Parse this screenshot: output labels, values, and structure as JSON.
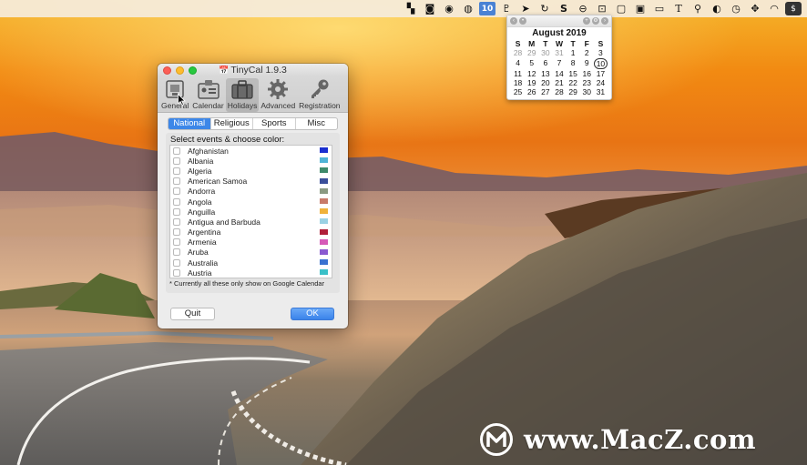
{
  "menubar": {
    "date_badge": "10",
    "icons": [
      "crop-icon",
      "camera-icon",
      "mic-icon",
      "globe-icon",
      "date-badge",
      "pin-icon",
      "send-icon",
      "refresh-icon",
      "s-icon",
      "display-icon",
      "box-icon",
      "window-icon",
      "screen-icon",
      "monitor-icon",
      "text-icon",
      "search-icon",
      "color-icon",
      "clock-icon",
      "drag-icon",
      "wifi-icon",
      "s-app-icon"
    ],
    "text_glyphs": {
      "s": "S",
      "text": "T"
    }
  },
  "calendar": {
    "month_title": "August 2019",
    "weekdays": [
      "S",
      "M",
      "T",
      "W",
      "T",
      "F",
      "S"
    ],
    "weeks": [
      [
        "28",
        "29",
        "30",
        "31",
        "1",
        "2",
        "3"
      ],
      [
        "4",
        "5",
        "6",
        "7",
        "8",
        "9",
        "10"
      ],
      [
        "11",
        "12",
        "13",
        "14",
        "15",
        "16",
        "17"
      ],
      [
        "18",
        "19",
        "20",
        "21",
        "22",
        "23",
        "24"
      ],
      [
        "25",
        "26",
        "27",
        "28",
        "29",
        "30",
        "31"
      ]
    ],
    "dim_days_first_week": 4,
    "today": "10"
  },
  "window": {
    "title": "TinyCal 1.9.3",
    "toolbar": [
      {
        "label": "General",
        "icon": "general-icon"
      },
      {
        "label": "Calendar",
        "icon": "calendar-card-icon"
      },
      {
        "label": "Holidays",
        "icon": "suitcase-icon"
      },
      {
        "label": "Advanced",
        "icon": "gear-icon"
      },
      {
        "label": "Registration",
        "icon": "key-icon"
      }
    ],
    "selected_toolbar": "Holidays",
    "tabs": [
      "National",
      "Religious",
      "Sports",
      "Misc"
    ],
    "selected_tab": "National",
    "prompt": "Select events & choose color:",
    "countries": [
      {
        "name": "Afghanistan",
        "color": "#1a2fd0"
      },
      {
        "name": "Albania",
        "color": "#4fb4d6"
      },
      {
        "name": "Algeria",
        "color": "#3e8a6a"
      },
      {
        "name": "American Samoa",
        "color": "#3a4f9a"
      },
      {
        "name": "Andorra",
        "color": "#8a9a82"
      },
      {
        "name": "Angola",
        "color": "#c87a6a"
      },
      {
        "name": "Anguilla",
        "color": "#f0b23a"
      },
      {
        "name": "Antigua and Barbuda",
        "color": "#9ad2e4"
      },
      {
        "name": "Argentina",
        "color": "#b0203a"
      },
      {
        "name": "Armenia",
        "color": "#d65ab8"
      },
      {
        "name": "Aruba",
        "color": "#8a5ad0"
      },
      {
        "name": "Australia",
        "color": "#3a72d0"
      },
      {
        "name": "Austria",
        "color": "#3ac0c8"
      }
    ],
    "note": "* Currently all these only show on Google Calendar",
    "quit_label": "Quit",
    "ok_label": "OK"
  },
  "watermark": {
    "text": "www.MacZ.com"
  }
}
